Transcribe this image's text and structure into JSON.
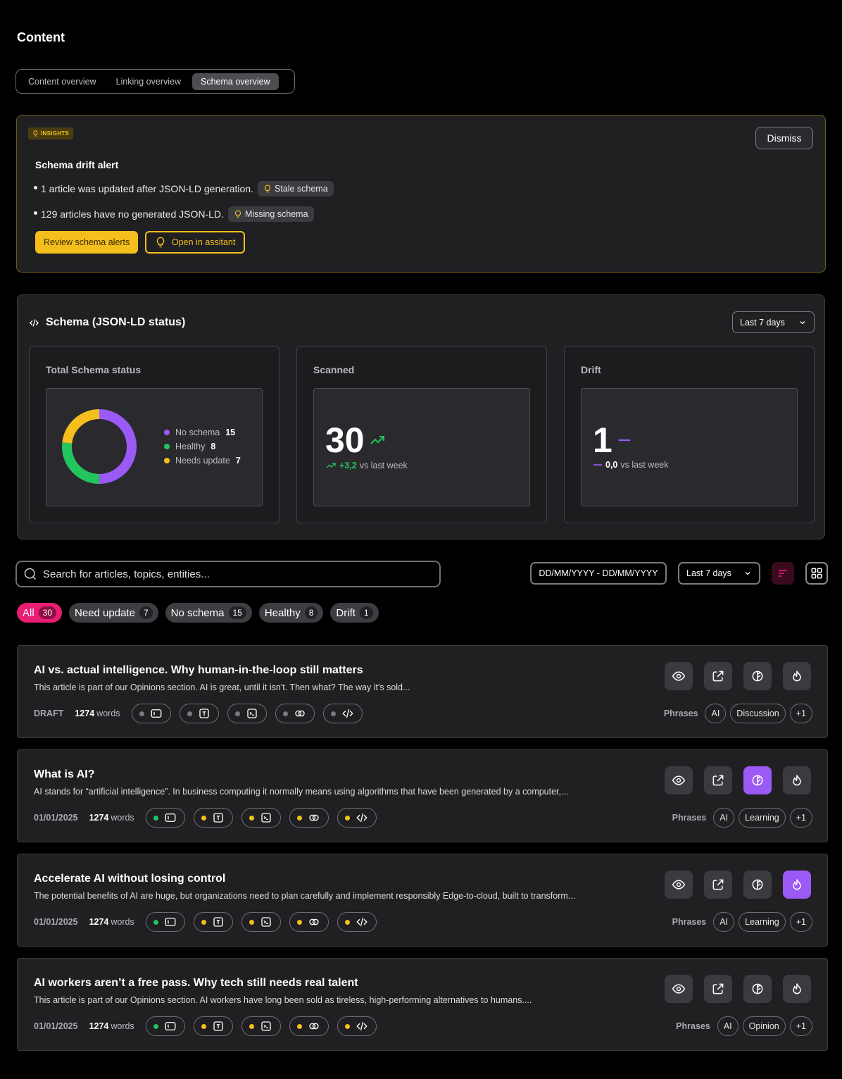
{
  "page": {
    "title": "Content"
  },
  "tabs": [
    {
      "label": "Content overview"
    },
    {
      "label": "Linking overview"
    },
    {
      "label": "Schema overview"
    }
  ],
  "insights": {
    "badge": "INSIGHTS",
    "dismiss": "Dismiss",
    "title": "Schema drift alert",
    "bullets": [
      {
        "text": "1 article was updated after JSON-LD generation.",
        "chip": "Stale schema"
      },
      {
        "text": "129 articles have no generated JSON-LD.",
        "chip": "Missing schema"
      }
    ],
    "primary_button": "Review schema alerts",
    "secondary_button": "Open in assitant"
  },
  "schema_panel": {
    "title": "Schema (JSON-LD status)",
    "range": "Last 7 days",
    "total": {
      "label": "Total Schema status",
      "legend": [
        {
          "name": "No schema",
          "value": "15",
          "color": "#9b59f6"
        },
        {
          "name": "Healthy",
          "value": "8",
          "color": "#22c55e"
        },
        {
          "name": "Needs update",
          "value": "7",
          "color": "#f4bf1c"
        }
      ]
    },
    "scanned": {
      "label": "Scanned",
      "value": "30",
      "delta": "+3,2",
      "suffix": "vs last week",
      "color": "#22c55e"
    },
    "drift": {
      "label": "Drift",
      "value": "1",
      "delta": "0,0",
      "suffix": "vs last week",
      "color": "#9b59f6"
    }
  },
  "filters": {
    "search_placeholder": "Search for articles, topics, entities...",
    "date_range": "DD/MM/YYYY - DD/MM/YYYY",
    "range": "Last 7 days",
    "pills": [
      {
        "label": "All",
        "count": "30"
      },
      {
        "label": "Need update",
        "count": "7"
      },
      {
        "label": "No schema",
        "count": "15"
      },
      {
        "label": "Healthy",
        "count": "8"
      },
      {
        "label": "Drift",
        "count": "1"
      }
    ]
  },
  "phrases_label": "Phrases",
  "words_label": "words",
  "articles": [
    {
      "title": "AI vs. actual intelligence. Why human-in-the-loop still matters",
      "desc": "This article is part of our Opinions section. AI is great, until it isn't. Then what? The way it's sold...",
      "date": "DRAFT",
      "words": "1274",
      "phrases": [
        "AI",
        "Discussion",
        "+1"
      ]
    },
    {
      "title": "What is AI?",
      "desc": "AI stands for “artificial intelligence”. In business computing it normally means using algorithms that have been generated by a computer,...",
      "date": "01/01/2025",
      "words": "1274",
      "phrases": [
        "AI",
        "Learning",
        "+1"
      ]
    },
    {
      "title": "Accelerate AI without losing control",
      "desc": "The potential benefits of AI are huge, but organizations need to plan carefully and implement responsibly Edge-to-cloud, built to transform...",
      "date": "01/01/2025",
      "words": "1274",
      "phrases": [
        "AI",
        "Learning",
        "+1"
      ]
    },
    {
      "title": "AI workers aren’t a free pass. Why tech still needs real talent",
      "desc": "This article is part of our Opinions section. AI workers have long been sold as tireless, high-performing alternatives to humans....",
      "date": "01/01/2025",
      "words": "1274",
      "phrases": [
        "AI",
        "Opinion",
        "+1"
      ]
    }
  ]
}
